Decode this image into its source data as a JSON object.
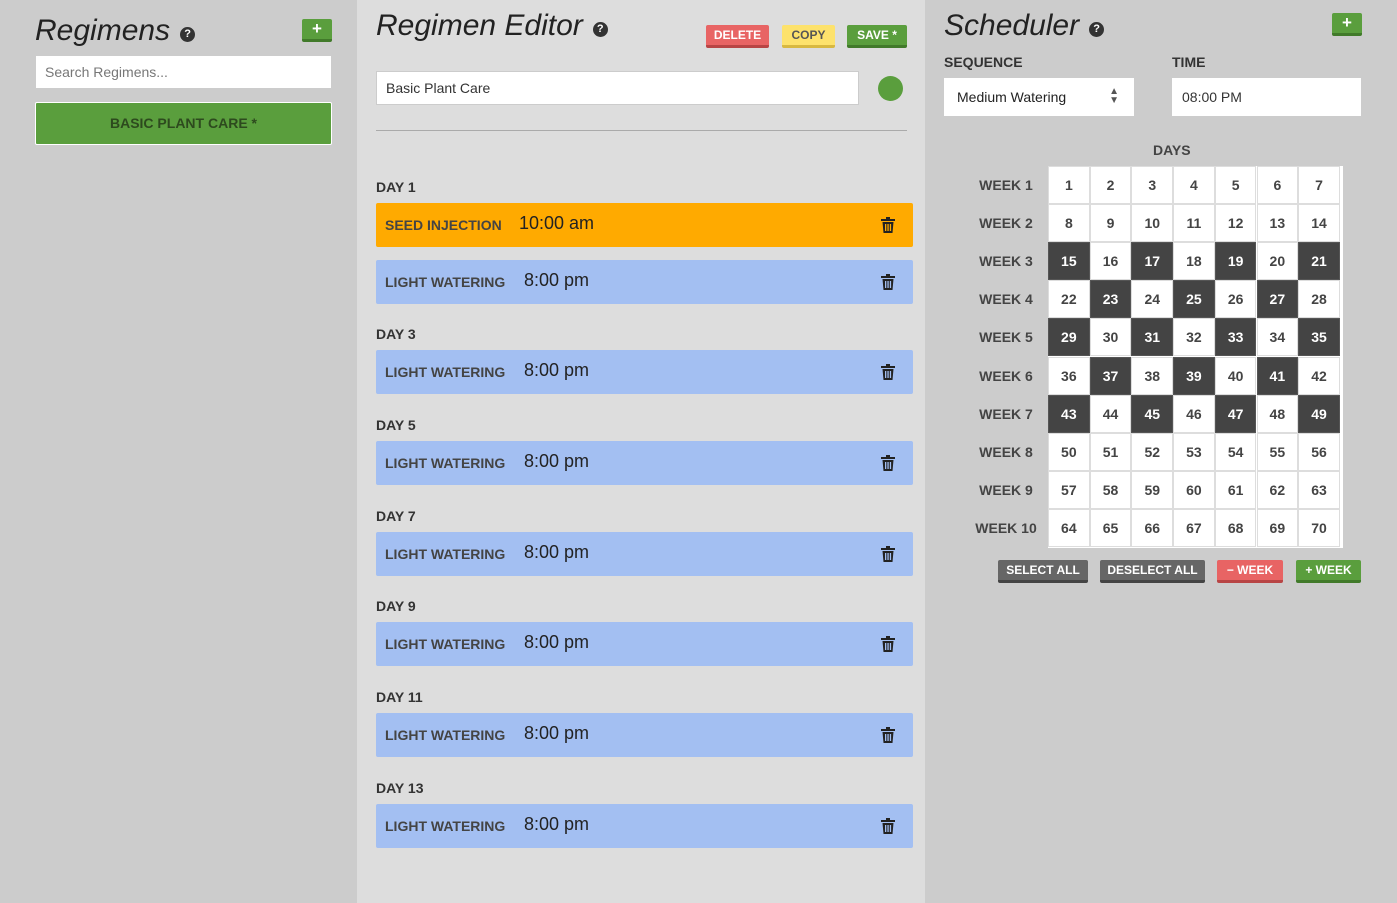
{
  "regimens": {
    "title": "Regimens",
    "help_icon": "question-circle-icon",
    "add_icon": "plus-icon",
    "add_label": "+",
    "search_placeholder": "Search Regimens...",
    "items": [
      {
        "label": "BASIC PLANT CARE *"
      }
    ]
  },
  "editor": {
    "title": "Regimen Editor",
    "help_icon": "question-circle-icon",
    "delete_label": "DELETE",
    "copy_label": "COPY",
    "save_label": "SAVE *",
    "name_value": "Basic Plant Care",
    "color": "#5a9e3d",
    "days": [
      {
        "label": "DAY 1",
        "events": [
          {
            "name": "SEED INJECTION",
            "time": "10:00 am",
            "kind": "seed"
          },
          {
            "name": "LIGHT WATERING",
            "time": "8:00 pm",
            "kind": "water"
          }
        ]
      },
      {
        "label": "DAY 3",
        "events": [
          {
            "name": "LIGHT WATERING",
            "time": "8:00 pm",
            "kind": "water"
          }
        ]
      },
      {
        "label": "DAY 5",
        "events": [
          {
            "name": "LIGHT WATERING",
            "time": "8:00 pm",
            "kind": "water"
          }
        ]
      },
      {
        "label": "DAY 7",
        "events": [
          {
            "name": "LIGHT WATERING",
            "time": "8:00 pm",
            "kind": "water"
          }
        ]
      },
      {
        "label": "DAY 9",
        "events": [
          {
            "name": "LIGHT WATERING",
            "time": "8:00 pm",
            "kind": "water"
          }
        ]
      },
      {
        "label": "DAY 11",
        "events": [
          {
            "name": "LIGHT WATERING",
            "time": "8:00 pm",
            "kind": "water"
          }
        ]
      },
      {
        "label": "DAY 13",
        "events": [
          {
            "name": "LIGHT WATERING",
            "time": "8:00 pm",
            "kind": "water"
          }
        ]
      }
    ],
    "trash_icon": "trash-icon"
  },
  "scheduler": {
    "title": "Scheduler",
    "help_icon": "question-circle-icon",
    "add_label": "+",
    "sequence_label": "SEQUENCE",
    "sequence_value": "Medium Watering",
    "time_label": "TIME",
    "time_value": "08:00 PM",
    "days_label": "DAYS",
    "weeks": [
      "WEEK 1",
      "WEEK 2",
      "WEEK 3",
      "WEEK 4",
      "WEEK 5",
      "WEEK 6",
      "WEEK 7",
      "WEEK 8",
      "WEEK 9",
      "WEEK 10"
    ],
    "selected_days": [
      15,
      17,
      19,
      21,
      23,
      25,
      27,
      29,
      31,
      33,
      35,
      37,
      39,
      41,
      43,
      45,
      47,
      49
    ],
    "select_all_label": "SELECT ALL",
    "deselect_all_label": "DESELECT ALL",
    "remove_week_label": "− WEEK",
    "add_week_label": "+ WEEK"
  },
  "colors": {
    "green": "#5a9e3d",
    "red": "#e86464",
    "yellow": "#fde26c",
    "orange": "#ffaa00",
    "blue": "#a3bff2",
    "selected_day": "#444444"
  }
}
